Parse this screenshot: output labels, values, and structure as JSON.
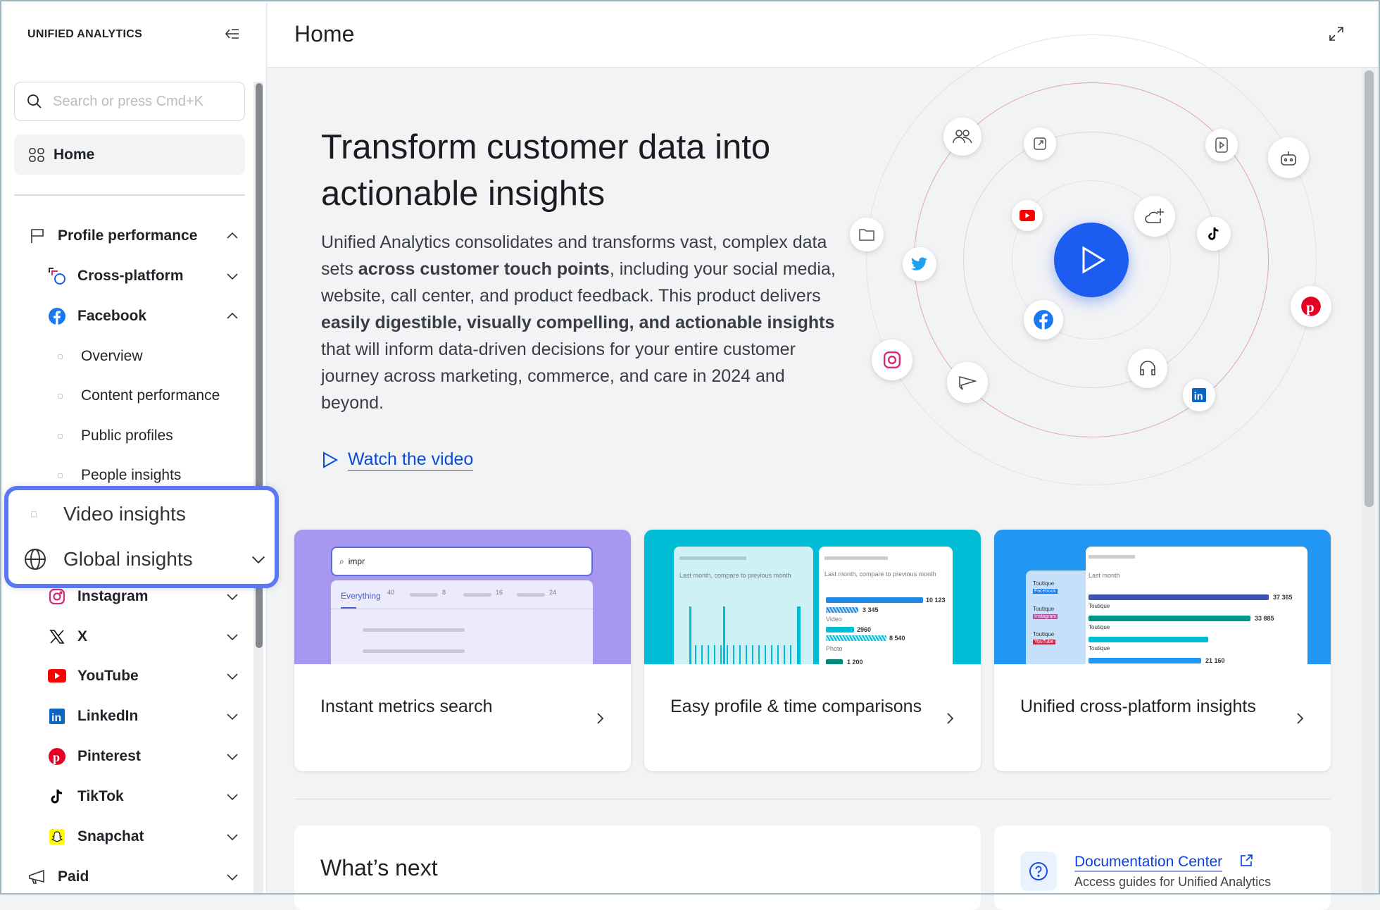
{
  "app": {
    "brand": "UNIFIED ANALYTICS"
  },
  "search": {
    "placeholder": "Search or press Cmd+K"
  },
  "sidebar": {
    "home": "Home",
    "profile_performance": "Profile performance",
    "cross_platform": "Cross-platform",
    "facebook": "Facebook",
    "facebook_items": [
      "Overview",
      "Content performance",
      "Public profiles",
      "People insights",
      "Video insights"
    ],
    "global_insights": "Global insights",
    "platforms": [
      {
        "label": "Instagram",
        "icon": "instagram-icon"
      },
      {
        "label": "X",
        "icon": "x-icon"
      },
      {
        "label": "YouTube",
        "icon": "youtube-icon"
      },
      {
        "label": "LinkedIn",
        "icon": "linkedin-icon"
      },
      {
        "label": "Pinterest",
        "icon": "pinterest-icon"
      },
      {
        "label": "TikTok",
        "icon": "tiktok-icon"
      },
      {
        "label": "Snapchat",
        "icon": "snapchat-icon"
      }
    ],
    "paid": "Paid"
  },
  "header": {
    "title": "Home"
  },
  "hero": {
    "title": "Transform customer data into actionable insights",
    "p1": "Unified Analytics consolidates and transforms vast, complex data sets ",
    "b1": "across customer touch points",
    "p2": ", including your social media, website, call center, and product feedback. This product delivers ",
    "b2": "easily digestible, visually compelling, and actionable insights",
    "p3": " that will inform data-driven decisions for your entire customer journey across marketing, commerce, and care in 2024 and beyond.",
    "watch": "Watch the video"
  },
  "cards": [
    {
      "title": "Instant metrics search",
      "search_value": "impr",
      "tab": "Everything",
      "counts": [
        "40",
        "8",
        "16",
        "24"
      ]
    },
    {
      "title": "Easy profile & time comparisons",
      "caption": "Last month, compare to previous month",
      "values": [
        "10 123",
        "3 345",
        "2960",
        "8 540",
        "1 200"
      ],
      "labels": [
        "Video",
        "Photo"
      ]
    },
    {
      "title": "Unified cross-platform insights",
      "caption": "Last month",
      "values": [
        "37 365",
        "33 885",
        "21 160"
      ],
      "profile": "Toutique",
      "networks": [
        "Facebook",
        "Instagram",
        "YouTube"
      ]
    }
  ],
  "whats_next": {
    "title": "What’s next"
  },
  "doc": {
    "link": "Documentation Center",
    "desc": "Access guides for Unified Analytics"
  },
  "colors": {
    "accent": "#1c5cf0",
    "highlight": "#5b77f2",
    "card1": "#a797f0",
    "card2": "#00bcd4",
    "card3": "#2196f3"
  }
}
